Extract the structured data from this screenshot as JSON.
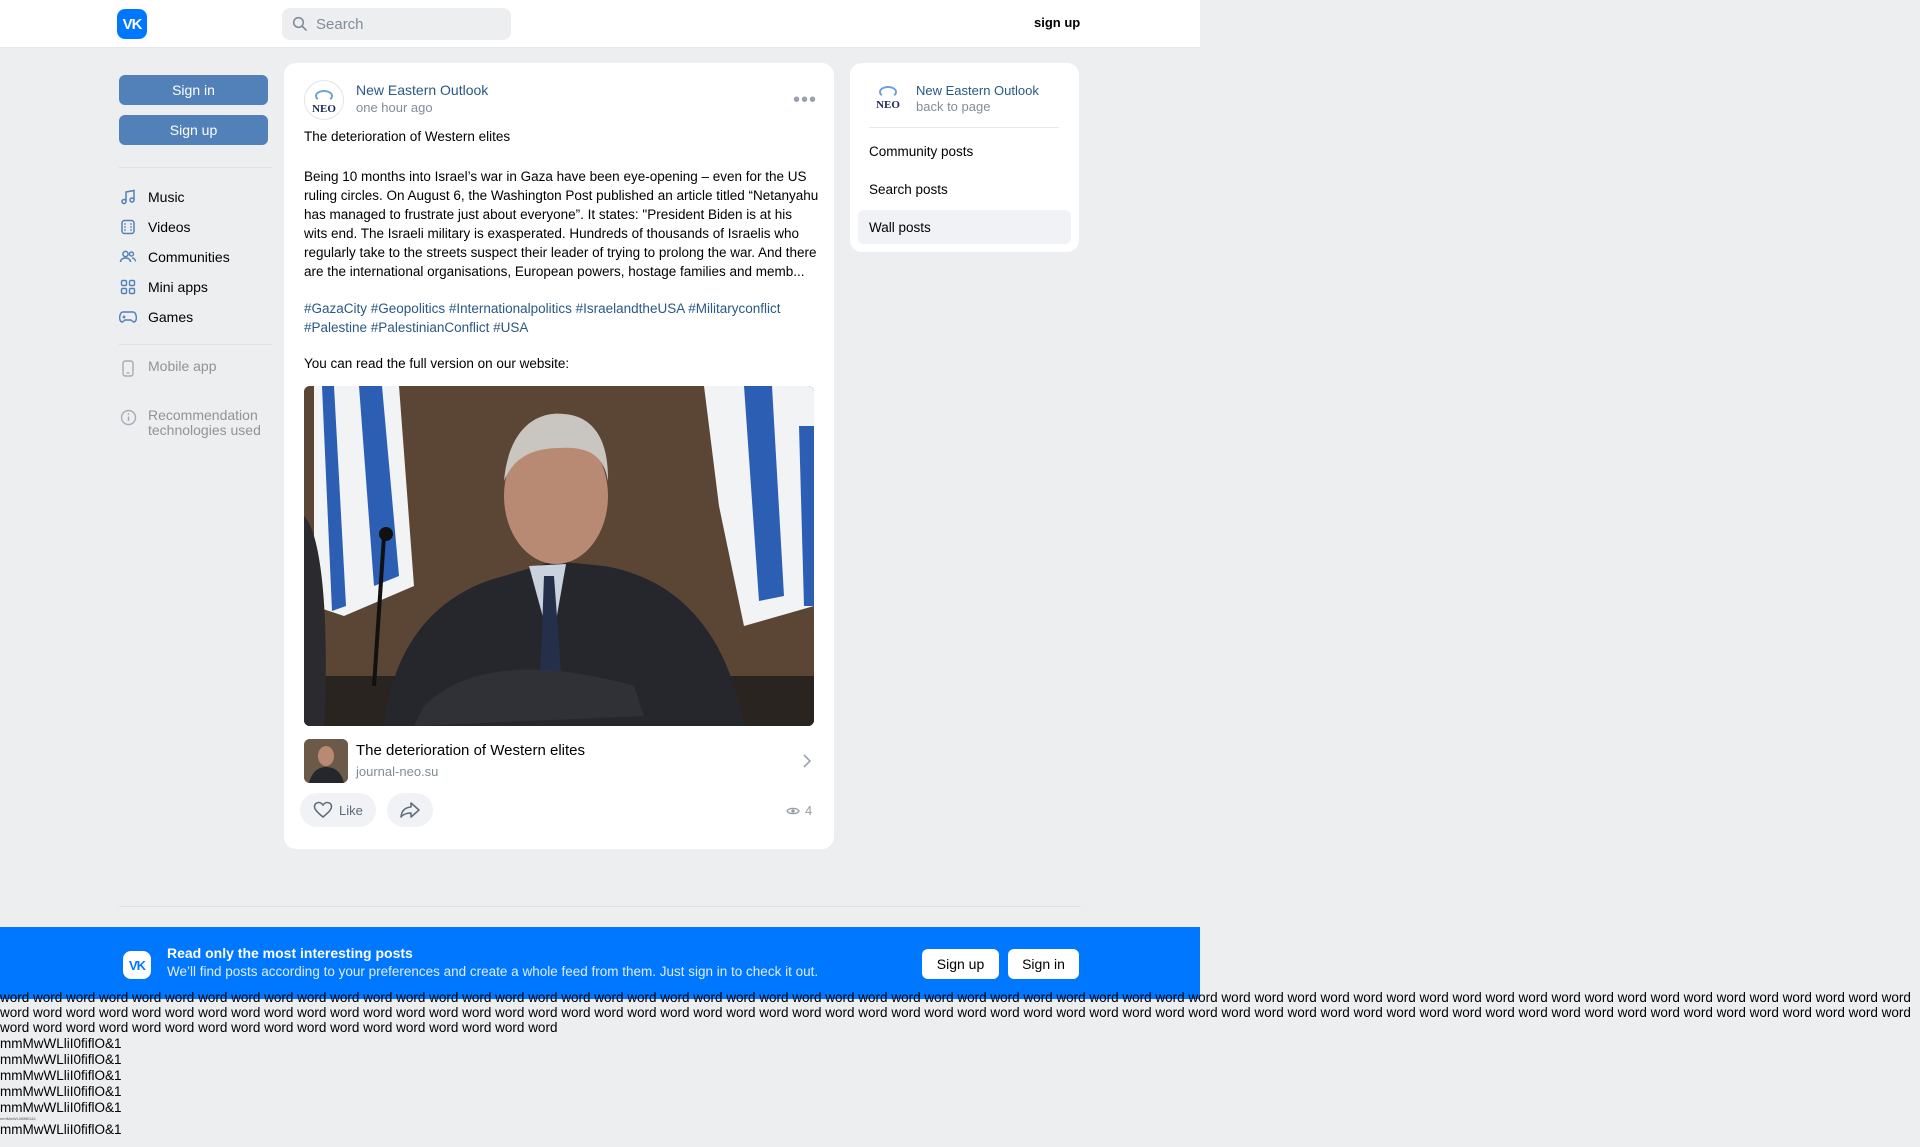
{
  "colors": {
    "accent": "#0077ff",
    "link": "#2a5885",
    "button": "#5181b8",
    "page_bg": "#edeef0"
  },
  "header": {
    "logo": "VK",
    "search_placeholder": "Search",
    "signup_label": "sign up"
  },
  "left_nav": {
    "sign_in": "Sign in",
    "sign_up": "Sign up",
    "items": [
      {
        "label": "Music",
        "icon": "music-icon"
      },
      {
        "label": "Videos",
        "icon": "video-icon"
      },
      {
        "label": "Communities",
        "icon": "communities-icon"
      },
      {
        "label": "Mini apps",
        "icon": "mini-apps-icon"
      },
      {
        "label": "Games",
        "icon": "gamepad-icon"
      }
    ],
    "mobile_app": "Mobile app",
    "recommendation": "Recommendation technologies used"
  },
  "post": {
    "author": "New Eastern Outlook",
    "avatar_text": "NEO",
    "time": "one hour ago",
    "title": "The deterioration of Western elites",
    "body": "Being 10 months into Israel’s war in Gaza have been eye-opening – even for the US ruling circles. On August 6, the Washington Post published an article titled “Netanyahu has managed to frustrate just about everyone”. It states: \"President Biden is at his wits end. The Israeli military is exasperated. Hundreds of thousands of Israelis who regularly take to the streets suspect their leader of trying to prolong the war. And there are the international organisations, European powers, hostage families and memb...",
    "hashtags": "#GazaCity #Geopolitics #Internationalpolitics #IsraelandtheUSA #Militaryconflict #Palestine #PalestinianConflict #USA",
    "read_full": "You can read the full version on our website:",
    "link_title": "The deterioration of Western elites",
    "link_domain": "journal-neo.su",
    "like_label": "Like",
    "views": "4"
  },
  "right_panel": {
    "name": "New Eastern Outlook",
    "back": "back to page",
    "items": [
      "Community posts",
      "Search posts",
      "Wall posts"
    ],
    "active_index": 2
  },
  "banner": {
    "logo": "VK",
    "title": "Read only the most interesting posts",
    "subtitle": "We’ll find posts according to your preferences and create a whole feed from them. Just sign in to check it out.",
    "sign_up": "Sign up",
    "sign_in": "Sign in"
  },
  "filler": {
    "words": "word word word word word word word word word word word word word word word word word word word word word word word word word word word word word word word word word word word word word word word word word word word word word word word word word word word word word word word word word word word word word word word word word word word word word word word word word word word word word word word word word word word word word word word word word word word word word word word word word word word word word word word word word word word word word word word word word word word word word word word word word word word word word word word word word word word word word",
    "probe": "mmMwWLliI0fiflO&1"
  }
}
